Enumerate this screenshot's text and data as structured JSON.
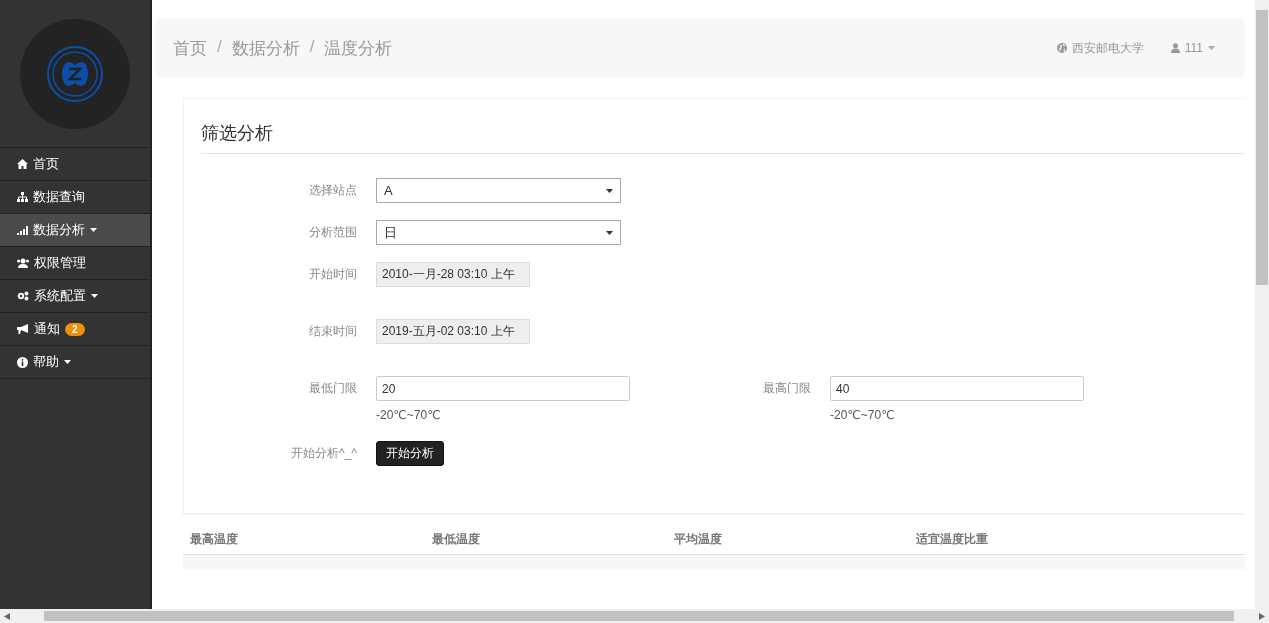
{
  "sidebar": {
    "menu": [
      {
        "label": "首页",
        "selected": false,
        "has_caret": false
      },
      {
        "label": "数据查询",
        "selected": false,
        "has_caret": false
      },
      {
        "label": "数据分析",
        "selected": true,
        "has_caret": true
      },
      {
        "label": "权限管理",
        "selected": false,
        "has_caret": false
      },
      {
        "label": "系统配置",
        "selected": false,
        "has_caret": true
      },
      {
        "label": "通知",
        "selected": false,
        "has_caret": false,
        "badge": "2"
      },
      {
        "label": "帮助",
        "selected": false,
        "has_caret": true
      }
    ]
  },
  "header": {
    "breadcrumb": [
      "首页",
      "数据分析",
      "温度分析"
    ],
    "separator": "/",
    "organization": "西安邮电大学",
    "user": "111"
  },
  "panel": {
    "title": "筛选分析",
    "rows": [
      {
        "fields": [
          {
            "kind": "select",
            "label": "选择站点",
            "value": "A"
          }
        ]
      },
      {
        "fields": [
          {
            "kind": "select",
            "label": "分析范围",
            "value": "日"
          }
        ]
      },
      {
        "fields": [
          {
            "kind": "date",
            "label": "开始时间",
            "value": "2010-一月-28 03:10 上午"
          }
        ]
      },
      {
        "fields": [
          {
            "kind": "date",
            "label": "结束时间",
            "value": "2019-五月-02 03:10 上午"
          }
        ]
      },
      {
        "fields": [
          {
            "kind": "number",
            "label": "最低门限",
            "value": "20",
            "hint": "-20℃~70℃"
          },
          {
            "kind": "number",
            "label": "最高门限",
            "value": "40",
            "hint": "-20℃~70℃"
          }
        ]
      }
    ],
    "action": {
      "label": "开始分析^_^",
      "button": "开始分析"
    }
  },
  "table": {
    "columns": [
      "最高温度",
      "最低温度",
      "平均温度",
      "适宜温度比重"
    ]
  }
}
